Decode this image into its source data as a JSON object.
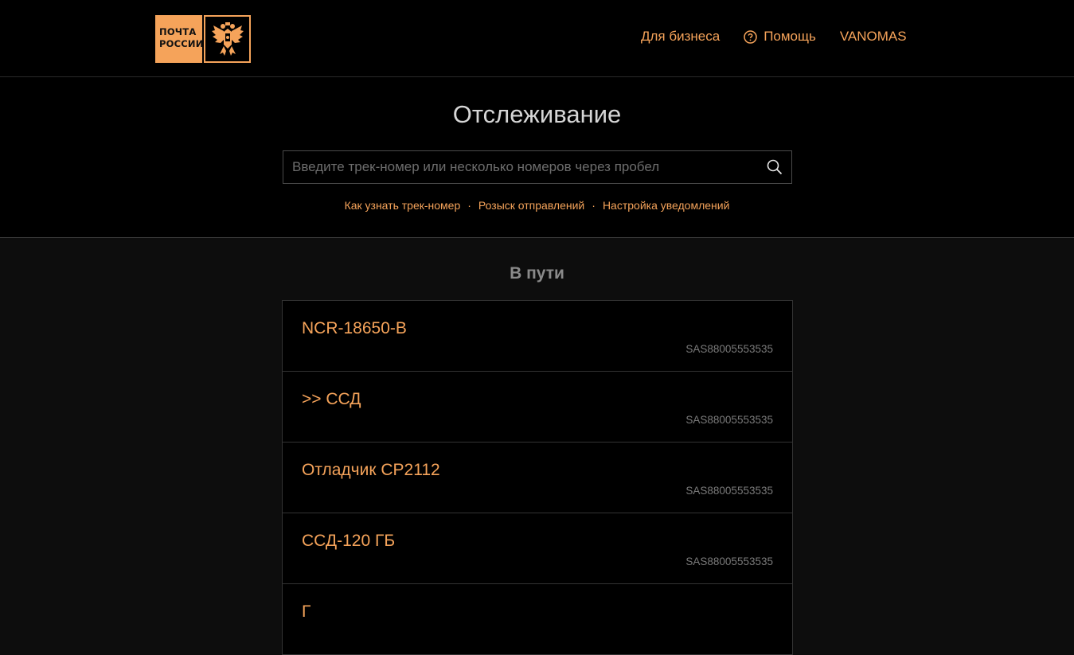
{
  "header": {
    "logo_text_line1": "ПОЧТА",
    "logo_text_line2": "РОССИИ",
    "nav": {
      "business": "Для бизнеса",
      "help": "Помощь",
      "user": "VANOMAS"
    }
  },
  "tracking": {
    "title": "Отслеживание",
    "search_placeholder": "Введите трек-номер или несколько номеров через пробел",
    "search_value": "",
    "links": [
      "Как узнать трек-номер",
      "Розыск отправлений",
      "Настройка уведомлений"
    ]
  },
  "in_transit": {
    "title": "В пути",
    "items": [
      {
        "name": "NCR-18650-B",
        "track": "SAS88005553535"
      },
      {
        "name": ">> ССД",
        "track": "SAS88005553535"
      },
      {
        "name": "Отладчик CP2112",
        "track": "SAS88005553535"
      },
      {
        "name": "ССД-120 ГБ",
        "track": "SAS88005553535"
      },
      {
        "name": "Г",
        "track": ""
      }
    ]
  },
  "colors": {
    "accent": "#f5a35a",
    "background": "#000000",
    "page_background": "#0d0d0d"
  },
  "icons": [
    "russian-eagle-emblem-icon",
    "question-circle-icon",
    "search-icon"
  ]
}
